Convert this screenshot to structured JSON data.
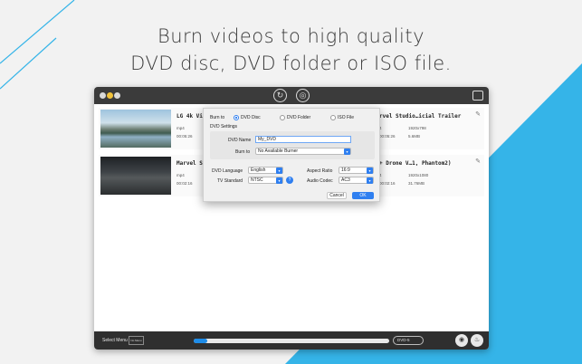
{
  "headline": {
    "line1": "Burn videos to high quality",
    "line2": "DVD disc, DVD folder or ISO file."
  },
  "colors": {
    "accent": "#2f7ff0",
    "background_blue": "#35b4e8",
    "titlebar": "#3b3b3b"
  },
  "toolbar": {
    "convert_icon": "refresh-icon",
    "burn_icon": "disc-icon",
    "gift_icon": "gift-icon"
  },
  "videos": [
    {
      "title": "LG 4k Vid",
      "format": "mp4",
      "duration": "00:05:26"
    },
    {
      "title": "Marvel St",
      "format": "mp4",
      "duration": "00:02:16"
    }
  ],
  "outputs": [
    {
      "title": "rvel Studio…icial Trailer",
      "format": "4",
      "duration": "00:05:26",
      "resolution": "1920x798",
      "size": "5.6MB"
    },
    {
      "title": "+ Drone V…1, Phantom2)",
      "format": "4",
      "duration": "00:02:16",
      "resolution": "1920x1080",
      "size": "31.76MB"
    }
  ],
  "dialog": {
    "burn_to_label": "Burn to",
    "options": [
      "DVD Disc",
      "DVD Folder",
      "ISO File"
    ],
    "selected_option": "DVD Disc",
    "settings_label": "DVD Settings",
    "dvd_name_label": "DVD Name",
    "dvd_name_value": "My_DVD",
    "burner_label": "Burn to",
    "burner_value": "No Available Burner",
    "language_label": "DVD Language",
    "language_value": "English",
    "aspect_label": "Aspect Ratio",
    "aspect_value": "16:9",
    "tv_label": "TV Standard",
    "tv_value": "NTSC",
    "audio_label": "Audio Codec",
    "audio_value": "AC3",
    "cancel_label": "Cancel",
    "ok_label": "OK"
  },
  "bottom": {
    "select_menu_label": "Select Menu",
    "no_menu_label": "No Menu",
    "progress": 0.07,
    "dvd_type": "DVD-5"
  }
}
